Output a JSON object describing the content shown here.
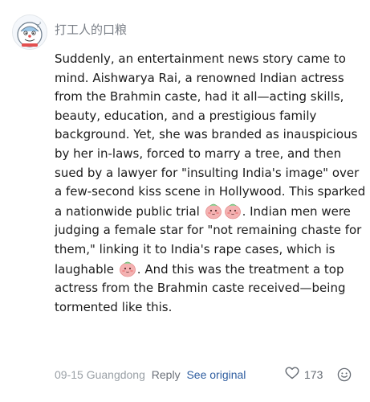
{
  "comment": {
    "author": "打工人的口粮",
    "paragraph": {
      "part1": "Suddenly, an entertainment news story came to mind. Aishwarya Rai, a renowned Indian actress from the Brahmin caste, had it all—acting skills, beauty, education, and a prestigious family background. Yet, she was branded as inauspicious by her in-laws, forced to marry a tree, and then sued by a lawyer for \"insulting India's image\" over a few-second kiss scene in Hollywood. This sparked a nationwide public trial ",
      "part2": ". Indian men were judging a female star for \"not remaining chaste for them,\" linking it to India's rape cases, which is laughable ",
      "part3": ". And this was the treatment a top actress from the Brahmin caste received—being tormented like this."
    },
    "emoji_name": "pink-blushing-face-emoji",
    "footer": {
      "date": "09-15",
      "location": "Guangdong",
      "reply_label": "Reply",
      "see_original_label": "See original",
      "like_count": "173"
    },
    "colors": {
      "text": "#1b1b1b",
      "meta": "#9aa0a6",
      "link": "#2f5ea0",
      "emoji": "#f0a8a8"
    },
    "icons": {
      "like": "heart-outline-icon",
      "react": "smiley-face-icon",
      "avatar": "cartoon-cat-avatar"
    }
  }
}
